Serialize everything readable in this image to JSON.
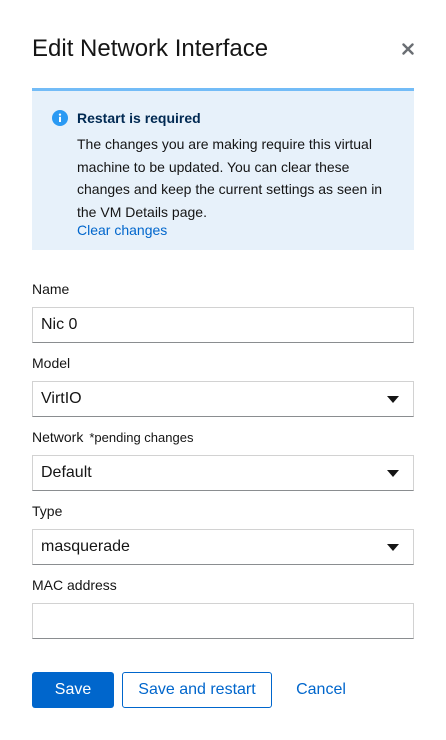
{
  "modal": {
    "title": "Edit Network Interface",
    "close_icon": "close-icon"
  },
  "alert": {
    "icon": "info-circle-icon",
    "title": "Restart is required",
    "body": "The changes you are making require this virtual machine to be updated. You can clear these changes and keep the current settings as seen in the VM Details page.",
    "link": "Clear changes",
    "colors": {
      "background": "#e7f1fa",
      "border": "#73bcf7",
      "icon": "#2b9af3",
      "title": "#002952"
    }
  },
  "form": {
    "name": {
      "label": "Name",
      "value": "Nic 0"
    },
    "model": {
      "label": "Model",
      "value": "VirtIO"
    },
    "network": {
      "label": "Network",
      "pending": "*pending changes",
      "value": "Default"
    },
    "type": {
      "label": "Type",
      "value": "masquerade"
    },
    "mac": {
      "label": "MAC address",
      "value": ""
    }
  },
  "actions": {
    "save": "Save",
    "save_restart": "Save and restart",
    "cancel": "Cancel"
  },
  "colors": {
    "accent": "#0066cc"
  }
}
